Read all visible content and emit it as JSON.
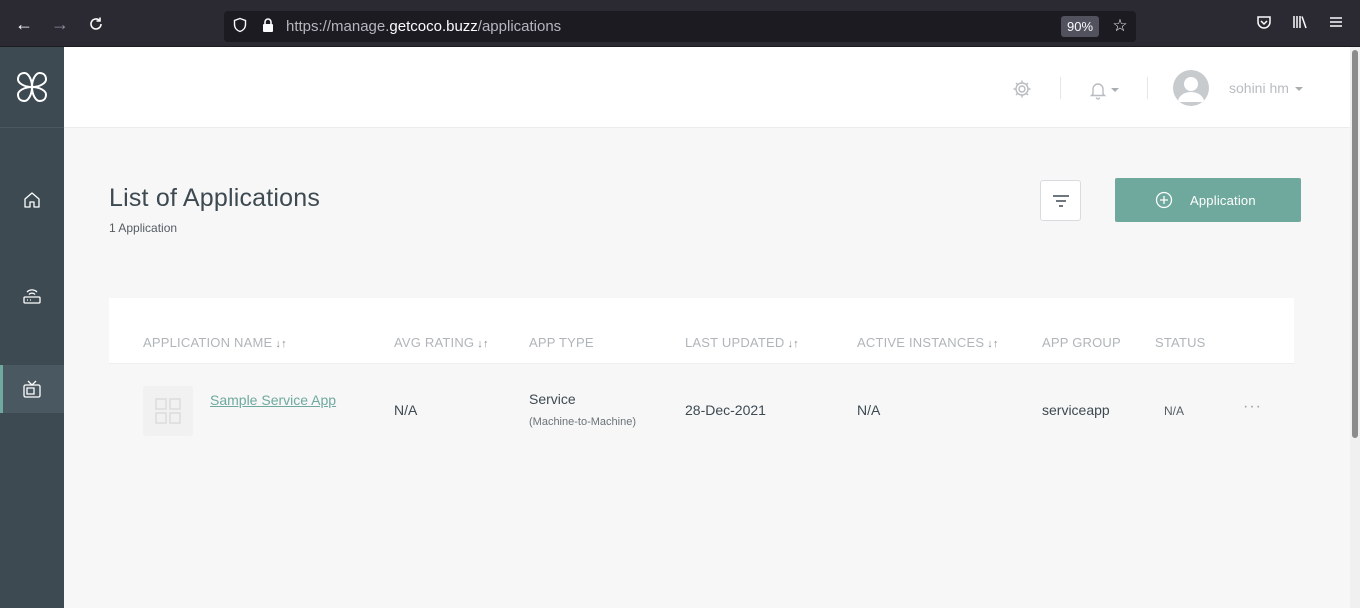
{
  "browser": {
    "url_prefix": "https://manage.",
    "url_host": "getcoco.buzz",
    "url_path": "/applications",
    "zoom": "90%"
  },
  "header": {
    "username": "sohini hm"
  },
  "page": {
    "title": "List of Applications",
    "count": "1 Application",
    "add_button_label": "Application"
  },
  "table": {
    "columns": [
      {
        "label": "APPLICATION NAME",
        "sort": "↓↑"
      },
      {
        "label": "AVG RATING",
        "sort": "↓↑"
      },
      {
        "label": "APP TYPE",
        "sort": ""
      },
      {
        "label": "LAST UPDATED",
        "sort": "↓↑"
      },
      {
        "label": "ACTIVE INSTANCES",
        "sort": "↓↑"
      },
      {
        "label": "APP GROUP",
        "sort": ""
      },
      {
        "label": "STATUS",
        "sort": ""
      }
    ],
    "rows": [
      {
        "name": "Sample Service App",
        "avg_rating": "N/A",
        "app_type": "Service",
        "app_type_detail": "(Machine-to-Machine)",
        "last_updated": "28-Dec-2021",
        "active_instances": "N/A",
        "app_group": "serviceapp",
        "status": "N/A",
        "more": "···"
      }
    ]
  },
  "colors": {
    "accent": "#6fa99e",
    "sidebar": "#3d4a52"
  }
}
